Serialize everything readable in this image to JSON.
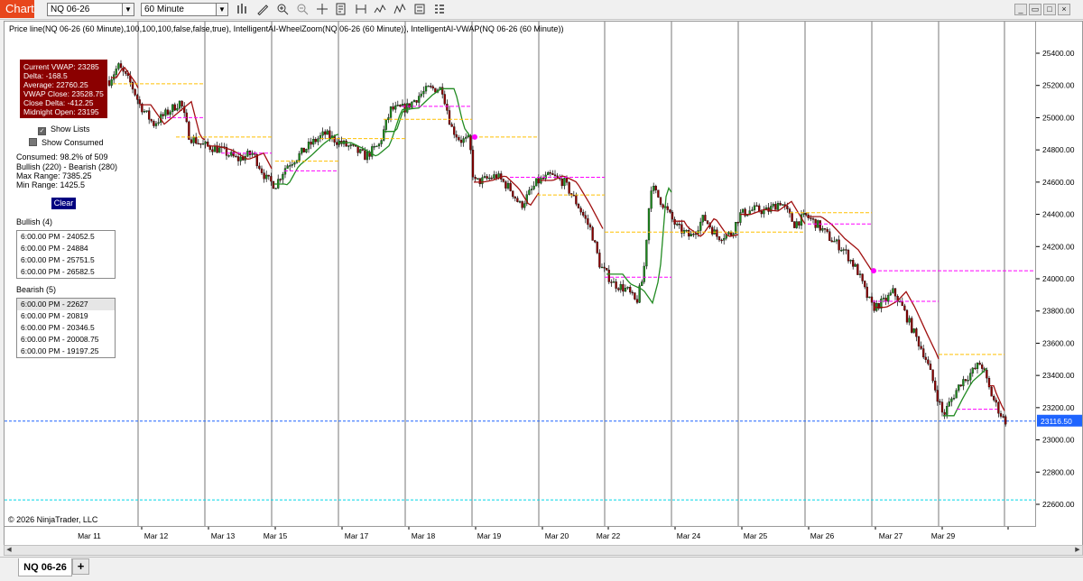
{
  "toolbar": {
    "chart_tab": "Chart",
    "instrument": "NQ 06-26",
    "interval": "60 Minute",
    "tool_icons": [
      "bar-type-icon",
      "draw-icon",
      "zoom-in-icon",
      "zoom-out-icon",
      "crosshair-icon",
      "properties-icon",
      "data-box-icon",
      "indicators-icon",
      "strategies-icon",
      "templates-icon",
      "grid-icon"
    ],
    "window_buttons": [
      "minimize-icon",
      "restore-icon",
      "maximize-icon",
      "close-icon"
    ]
  },
  "chart": {
    "indicator_label": "Price line(NQ 06-26 (60 Minute),100,100,100,false,false,true), IntelligentAI-WheelZoom(NQ 06-26 (60 Minute)), IntelligentAI-VWAP(NQ 06-26 (60 Minute))",
    "copyright": "© 2026 NinjaTrader, LLC",
    "last_price_label": "23116.50",
    "colors": {
      "up": "#1f8a1f",
      "down": "#8b0000",
      "vwap_up": "#228b22",
      "vwap_down": "#a01010",
      "yellow_level": "#ffc000",
      "magenta_level": "#ff00ff",
      "price_line": "#1e64ff",
      "cyan_line": "#00d8e8"
    }
  },
  "vwap_panel": {
    "current_vwap": "Current VWAP: 23285",
    "delta": "Delta: -168.5",
    "average": "Average: 22760.25",
    "vwap_close": "VWAP Close: 23528.75",
    "close_delta": "Close Delta: -412.25",
    "midnight_open": "Midnight Open: 23195"
  },
  "controls": {
    "show_lists": "Show Lists",
    "show_consumed": "Show Consumed",
    "consumed": "Consumed: 98.2% of 509",
    "bull_bear": "Bullish (220) - Bearish (280)",
    "max_range": "Max Range: 7385.25",
    "min_range": "Min Range: 1425.5",
    "clear": "Clear"
  },
  "bullish": {
    "title": "Bullish (4)",
    "items": [
      "6:00.00 PM - 24052.5",
      "6:00.00 PM - 24884",
      "6:00.00 PM - 25751.5",
      "6:00.00 PM - 26582.5"
    ]
  },
  "bearish": {
    "title": "Bearish (5)",
    "items": [
      "6:00.00 PM - 22627",
      "6:00.00 PM - 20819",
      "6:00.00 PM - 20346.5",
      "6:00.00 PM - 20008.75",
      "6:00.00 PM - 19197.25"
    ]
  },
  "axis": {
    "y_ticks": [
      "25400.00",
      "25200.00",
      "25000.00",
      "24800.00",
      "24600.00",
      "24400.00",
      "24200.00",
      "24000.00",
      "23800.00",
      "23600.00",
      "23400.00",
      "23200.00",
      "23000.00",
      "22800.00",
      "22600.00"
    ],
    "x_ticks": [
      "Mar 11",
      "Mar 12",
      "Mar 13",
      "Mar 15",
      "Mar 17",
      "Mar 18",
      "Mar 19",
      "Mar 20",
      "Mar 22",
      "Mar 24",
      "Mar 25",
      "Mar 26",
      "Mar 27",
      "Mar 29"
    ]
  },
  "bottom": {
    "instrument_tab": "NQ 06-26",
    "add_tab": "+"
  }
}
